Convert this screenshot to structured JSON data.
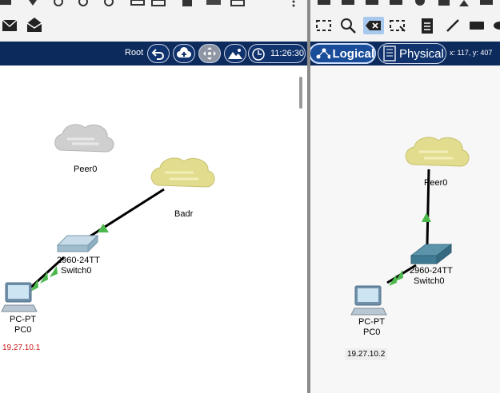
{
  "nav": {
    "root_label": "Root",
    "time": "11:26:30",
    "logical_tab": "Logical",
    "physical_tab": "Physical",
    "coords": "x: 117, y: 407"
  },
  "left_workspace": {
    "cloud_gray_label": "Peer0",
    "cloud_label": "Badr",
    "switch_model": "2960-24TT",
    "switch_name": "Switch0",
    "pc_model": "PC-PT",
    "pc_name": "PC0",
    "pc_ip": "19.27.10.1",
    "ip_color": "#cc1a1a"
  },
  "right_workspace": {
    "cloud_label": "Peer0",
    "switch_model": "2960-24TT",
    "switch_name": "Switch0",
    "pc_model": "PC-PT",
    "pc_name": "PC0",
    "pc_ip": "19.27.10.2"
  },
  "icons": [
    "mail-icon",
    "open-mail-icon",
    "search-icon",
    "zoom-icon",
    "undo-icon",
    "cloud-add-icon",
    "move-icon",
    "background-icon",
    "clock-icon",
    "logical-icon",
    "physical-icon",
    "select-icon",
    "delete-icon",
    "resize-icon",
    "note-icon",
    "draw-line-icon",
    "rectangle-icon"
  ]
}
